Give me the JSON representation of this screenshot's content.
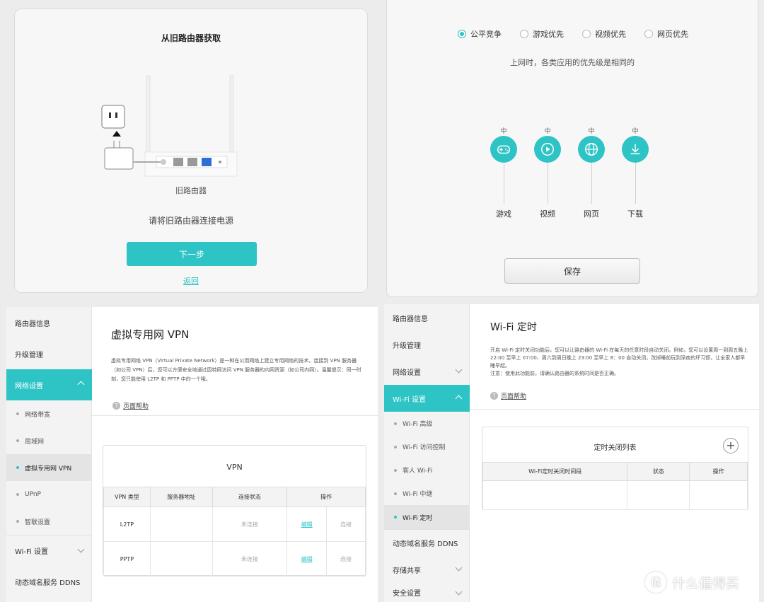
{
  "panel1": {
    "title": "从旧路由器获取",
    "router_label": "旧路由器",
    "instruction": "请将旧路由器连接电源",
    "next_label": "下一步",
    "back_label": "返回"
  },
  "panel2": {
    "modes": [
      "公平竞争",
      "游戏优先",
      "视频优先",
      "网页优先"
    ],
    "selected_mode": "公平竞争",
    "description": "上网时，各类应用的优先级是相同的",
    "apps": [
      {
        "level": "中",
        "name": "游戏",
        "icon": "gamepad-icon"
      },
      {
        "level": "中",
        "name": "视频",
        "icon": "play-icon"
      },
      {
        "level": "中",
        "name": "网页",
        "icon": "globe-icon"
      },
      {
        "level": "中",
        "name": "下载",
        "icon": "download-icon"
      }
    ],
    "save_label": "保存"
  },
  "panel3": {
    "sidebar": {
      "router_info": "路由器信息",
      "upgrade": "升级管理",
      "network": "网络设置",
      "sub": [
        "网络带宽",
        "局域网",
        "虚拟专用网 VPN",
        "UPnP",
        "智联设置"
      ],
      "wifi": "Wi-Fi 设置",
      "ddns": "动态域名服务 DDNS"
    },
    "title": "虚拟专用网 VPN",
    "description": "虚拟专用网络 VPN（Virtual Private Network）是一种在公用网络上建立专用网络的技术。连接到 VPN 服务器（如公司 VPN）后，您可以方便安全地通过因特网访问 VPN 服务器的内网资源（如公司内网）。温馨提示：同一时刻，您只能使用 L2TP 和 PPTP 中的一个哦。",
    "help": "页面帮助",
    "card_title": "VPN",
    "headers": [
      "VPN 类型",
      "服务器地址",
      "连接状态",
      "操作"
    ],
    "rows": [
      {
        "type": "L2TP",
        "server": "",
        "status": "未连接",
        "edit": "编辑",
        "connect": "连接"
      },
      {
        "type": "PPTP",
        "server": "",
        "status": "未连接",
        "edit": "编辑",
        "connect": "连接"
      }
    ]
  },
  "panel4": {
    "sidebar": {
      "router_info": "路由器信息",
      "upgrade": "升级管理",
      "network": "网络设置",
      "wifi": "Wi-Fi 设置",
      "sub": [
        "Wi-Fi 高级",
        "Wi-Fi 访问控制",
        "客人 Wi-Fi",
        "Wi-Fi 中继",
        "Wi-Fi 定时"
      ],
      "ddns": "动态域名服务 DDNS",
      "storage": "存储共享",
      "security": "安全设置"
    },
    "title": "Wi-Fi 定时",
    "description": "开启 Wi-Fi 定时关闭功能后，您可以让路由器的 Wi-Fi 在每天的任意时段自动关闭。例如，您可以设置周一到周五晚上 22:00 至早上 07:00、周六到周日晚上 23:00 至早上 8：00 自动关闭，改掉睡前玩到深夜的坏习惯，让全家人都早睡早起。",
    "note": "注意：使用此功能前，请确认路由器的系统时间是否正确。",
    "help": "页面帮助",
    "card_title": "定时关闭列表",
    "headers": [
      "Wi-Fi定时关闭时间段",
      "状态",
      "操作"
    ]
  },
  "watermark": "什么值得买",
  "colors": {
    "accent": "#2ec4c6"
  }
}
